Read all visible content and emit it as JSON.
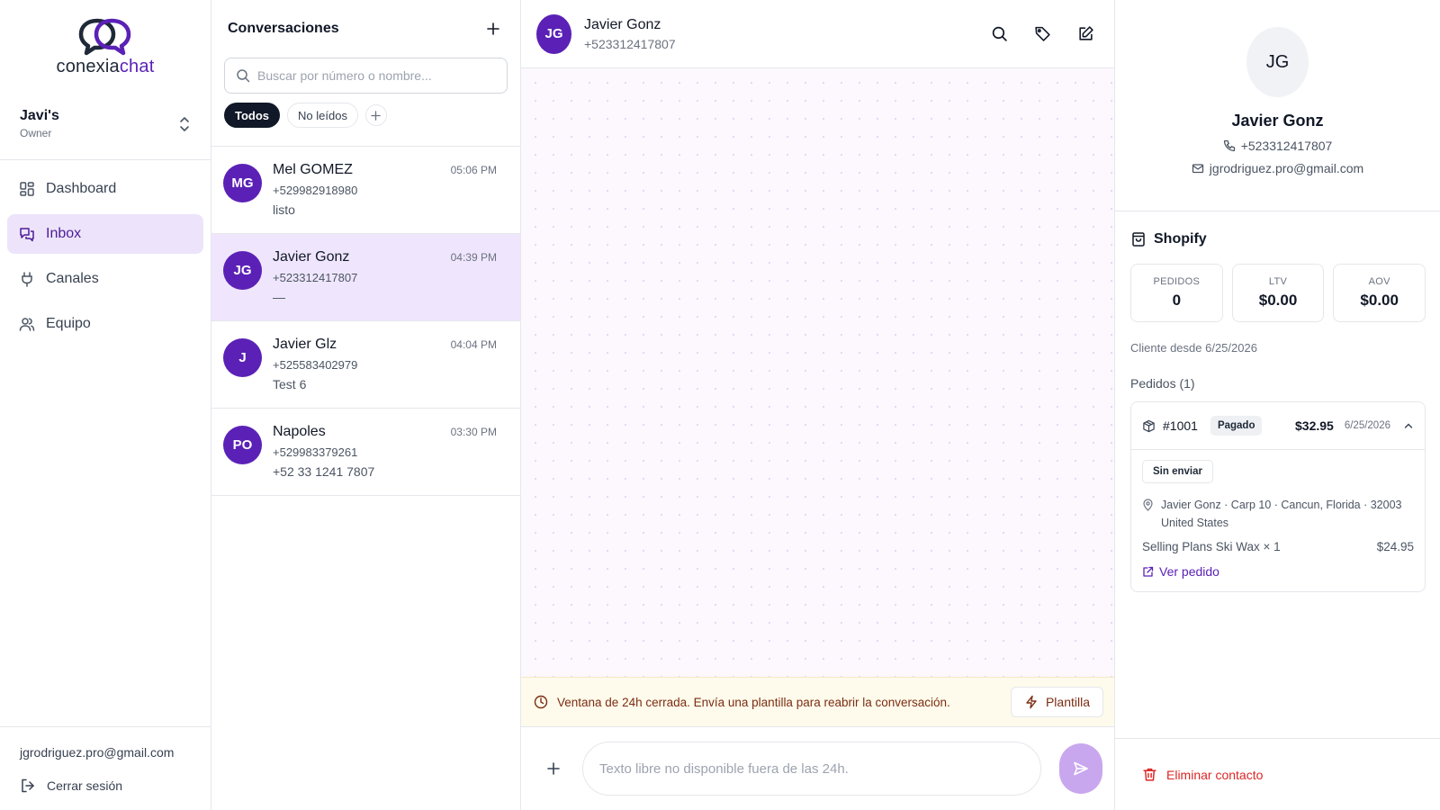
{
  "brand": {
    "logo_text_a": "conexia",
    "logo_text_b": "chat",
    "accent": "#5b21b6"
  },
  "workspace": {
    "name": "Javi's",
    "role": "Owner"
  },
  "nav": [
    {
      "label": "Dashboard",
      "icon": "grid-icon"
    },
    {
      "label": "Inbox",
      "icon": "chat-icon",
      "active": true
    },
    {
      "label": "Canales",
      "icon": "plug-icon"
    },
    {
      "label": "Equipo",
      "icon": "users-icon"
    }
  ],
  "user": {
    "email": "jgrodriguez.pro@gmail.com",
    "logout_label": "Cerrar sesión"
  },
  "conversations": {
    "title": "Conversaciones",
    "search_placeholder": "Buscar por número o nombre...",
    "filters": [
      "Todos",
      "No leídos"
    ],
    "items": [
      {
        "initials": "MG",
        "name": "Mel GOMEZ",
        "time": "05:06 PM",
        "phone": "+529982918980",
        "preview": "listo"
      },
      {
        "initials": "JG",
        "name": "Javier Gonz",
        "time": "04:39 PM",
        "phone": "+523312417807",
        "preview": "—",
        "selected": true
      },
      {
        "initials": "J",
        "name": "Javier Glz",
        "time": "04:04 PM",
        "phone": "+525583402979",
        "preview": "Test 6"
      },
      {
        "initials": "PO",
        "name": "Napoles",
        "time": "03:30 PM",
        "phone": "+529983379261",
        "preview": "+52 33 1241 7807"
      }
    ]
  },
  "chat": {
    "initials": "JG",
    "name": "Javier Gonz",
    "phone": "+523312417807",
    "banner_text": "Ventana de 24h cerrada. Envía una plantilla para reabrir la conversación.",
    "template_label": "Plantilla",
    "composer_placeholder": "Texto libre no disponible fuera de las 24h."
  },
  "contact": {
    "initials": "JG",
    "name": "Javier Gonz",
    "phone": "+523312417807",
    "email": "jgrodriguez.pro@gmail.com",
    "shopify": {
      "title": "Shopify",
      "stats": [
        {
          "label": "PEDIDOS",
          "value": "0"
        },
        {
          "label": "LTV",
          "value": "$0.00"
        },
        {
          "label": "AOV",
          "value": "$0.00"
        }
      ],
      "since": "Cliente desde 6/25/2026",
      "orders_title": "Pedidos (1)",
      "order": {
        "number": "#1001",
        "status": "Pagado",
        "total": "$32.95",
        "date": "6/25/2026",
        "fulfillment": "Sin enviar",
        "address_line1": "Javier Gonz · Carp 10 · Cancun, Florida · 32003",
        "address_line2": "United States",
        "item_name": "Selling Plans Ski Wax × 1",
        "item_price": "$24.95",
        "view_label": "Ver pedido"
      }
    },
    "delete_label": "Eliminar contacto"
  }
}
